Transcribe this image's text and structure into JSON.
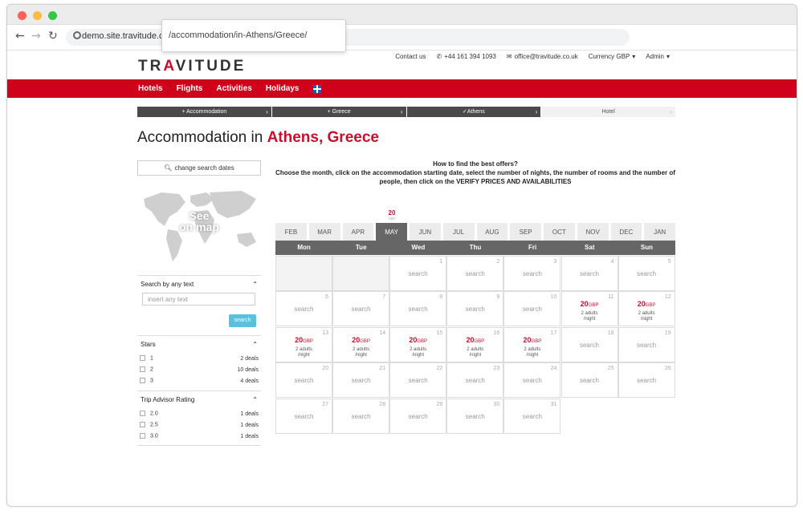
{
  "browser": {
    "url": "demo.site.travitude.co.uk",
    "url_popup": "/accommodation/in-Athens/Greece/"
  },
  "topbar": {
    "contact": "Contact us",
    "phone": "+44 161 394 1093",
    "email": "office@travitude.co.uk",
    "currency": "Currency GBP",
    "admin": "Admin"
  },
  "logo": {
    "pre": "TR",
    "accent": "A",
    "post": "VITUDE"
  },
  "menu": [
    "Hotels",
    "Flights",
    "Activities",
    "Holidays"
  ],
  "crumbs": [
    "+ Accommodation",
    "+ Greece",
    "✓Athens",
    "Hotel"
  ],
  "title": {
    "prefix": "Accommodation in",
    "highlight": "Athens, Greece"
  },
  "sidebar": {
    "change_dates": "change search dates",
    "map_label_1": "See",
    "map_label_2": "on map",
    "search": {
      "heading": "Search by any text",
      "placeholder": "insert any text",
      "button": "search"
    },
    "stars": {
      "heading": "Stars",
      "rows": [
        {
          "label": "1",
          "count": "2 deals"
        },
        {
          "label": "2",
          "count": "10 deals"
        },
        {
          "label": "3",
          "count": "4 deals"
        }
      ]
    },
    "rating": {
      "heading": "Trip Advisor Rating",
      "rows": [
        {
          "label": "2.0",
          "count": "1 deals"
        },
        {
          "label": "2.5",
          "count": "1 deals"
        },
        {
          "label": "3.0",
          "count": "1 deals"
        }
      ]
    }
  },
  "help": {
    "line1": "How to find the best offers?",
    "line2": "Choose the month, click on the accommodation starting date, select the number of nights, the number of rooms and the number of people, then click on the VERIFY PRICES AND AVAILABILITIES"
  },
  "month_price": {
    "value": "20",
    "currency": "GBP"
  },
  "months": [
    "FEB",
    "MAR",
    "APR",
    "MAY",
    "JUN",
    "JUL",
    "AUG",
    "SEP",
    "OCT",
    "NOV",
    "DEC",
    "JAN"
  ],
  "selected_month": "MAY",
  "weekdays": [
    "Mon",
    "Tue",
    "Wed",
    "Thu",
    "Fri",
    "Sat",
    "Sun"
  ],
  "calendar": {
    "leading_blanks": 2,
    "days": [
      {
        "d": "1"
      },
      {
        "d": "2"
      },
      {
        "d": "3"
      },
      {
        "d": "4"
      },
      {
        "d": "5"
      },
      {
        "d": "6"
      },
      {
        "d": "7"
      },
      {
        "d": "8"
      },
      {
        "d": "9"
      },
      {
        "d": "10"
      },
      {
        "d": "11",
        "price": "20",
        "cur": "GBP",
        "guests": "2 adults",
        "per": "/night"
      },
      {
        "d": "12",
        "price": "20",
        "cur": "GBP",
        "guests": "2 adults",
        "per": "/night"
      },
      {
        "d": "13",
        "price": "20",
        "cur": "GBP",
        "guests": "2 adults",
        "per": "/night"
      },
      {
        "d": "14",
        "price": "20",
        "cur": "GBP",
        "guests": "2 adults",
        "per": "/night"
      },
      {
        "d": "15",
        "price": "20",
        "cur": "GBP",
        "guests": "2 adults",
        "per": "/night"
      },
      {
        "d": "16",
        "price": "20",
        "cur": "GBP",
        "guests": "2 adults",
        "per": "/night"
      },
      {
        "d": "17",
        "price": "20",
        "cur": "GBP",
        "guests": "2 adults",
        "per": "/night"
      },
      {
        "d": "18"
      },
      {
        "d": "19"
      },
      {
        "d": "20"
      },
      {
        "d": "21"
      },
      {
        "d": "22"
      },
      {
        "d": "23"
      },
      {
        "d": "24"
      },
      {
        "d": "25"
      },
      {
        "d": "26"
      },
      {
        "d": "27"
      },
      {
        "d": "28"
      },
      {
        "d": "29"
      },
      {
        "d": "30"
      },
      {
        "d": "31"
      }
    ],
    "search_label": "search"
  }
}
